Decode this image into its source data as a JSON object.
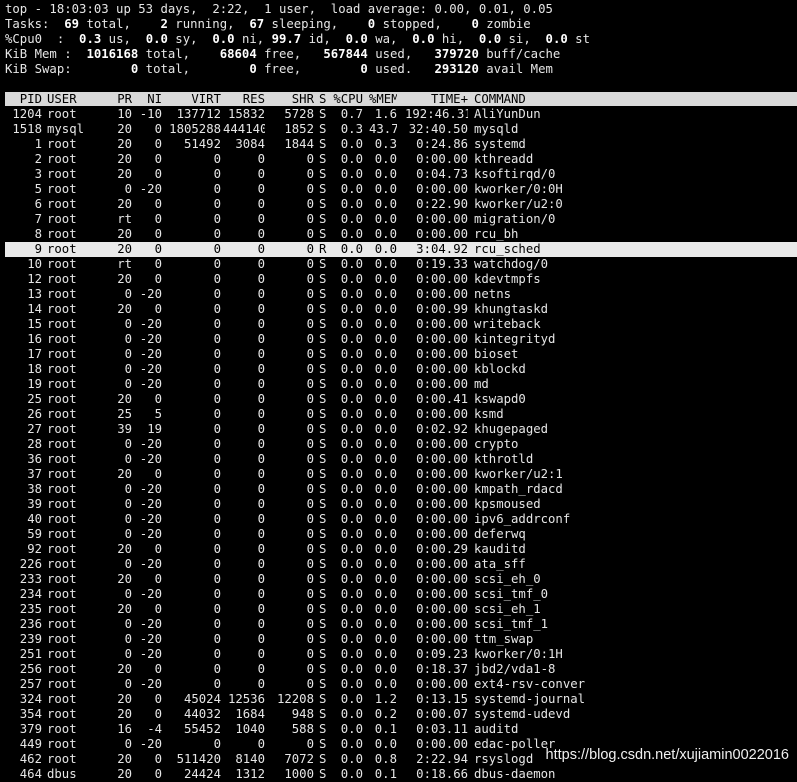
{
  "summary": {
    "top": {
      "time": "18:03:03",
      "uptime": "53 days,  2:22",
      "users": "1",
      "load": "0.00, 0.01, 0.05"
    },
    "tasks": {
      "total": "69",
      "running": "2",
      "sleeping": "67",
      "stopped": "0",
      "zombie": "0"
    },
    "cpu": {
      "us": "0.3",
      "sy": "0.0",
      "ni": "0.0",
      "id": "99.7",
      "wa": "0.0",
      "hi": "0.0",
      "si": "0.0",
      "st": "0.0"
    },
    "mem": {
      "total": "1016168",
      "free": "68604",
      "used": "567844",
      "buff": "379720"
    },
    "swap": {
      "total": "0",
      "free": "0",
      "used": "0",
      "avail": "293120"
    }
  },
  "columns": [
    "PID",
    "USER",
    "PR",
    "NI",
    "VIRT",
    "RES",
    "SHR",
    "S",
    "%CPU",
    "%MEM",
    "TIME+",
    "COMMAND"
  ],
  "processes": [
    [
      "1204",
      "root",
      "10",
      "-10",
      "137712",
      "15832",
      "5728",
      "S",
      "0.7",
      "1.6",
      "192:46.31",
      "AliYunDun"
    ],
    [
      "1518",
      "mysql",
      "20",
      "0",
      "1805288",
      "444140",
      "1852",
      "S",
      "0.3",
      "43.7",
      "32:40.50",
      "mysqld"
    ],
    [
      "1",
      "root",
      "20",
      "0",
      "51492",
      "3084",
      "1844",
      "S",
      "0.0",
      "0.3",
      "0:24.86",
      "systemd"
    ],
    [
      "2",
      "root",
      "20",
      "0",
      "0",
      "0",
      "0",
      "S",
      "0.0",
      "0.0",
      "0:00.00",
      "kthreadd"
    ],
    [
      "3",
      "root",
      "20",
      "0",
      "0",
      "0",
      "0",
      "S",
      "0.0",
      "0.0",
      "0:04.73",
      "ksoftirqd/0"
    ],
    [
      "5",
      "root",
      "0",
      "-20",
      "0",
      "0",
      "0",
      "S",
      "0.0",
      "0.0",
      "0:00.00",
      "kworker/0:0H"
    ],
    [
      "6",
      "root",
      "20",
      "0",
      "0",
      "0",
      "0",
      "S",
      "0.0",
      "0.0",
      "0:22.90",
      "kworker/u2:0"
    ],
    [
      "7",
      "root",
      "rt",
      "0",
      "0",
      "0",
      "0",
      "S",
      "0.0",
      "0.0",
      "0:00.00",
      "migration/0"
    ],
    [
      "8",
      "root",
      "20",
      "0",
      "0",
      "0",
      "0",
      "S",
      "0.0",
      "0.0",
      "0:00.00",
      "rcu_bh"
    ],
    [
      "9",
      "root",
      "20",
      "0",
      "0",
      "0",
      "0",
      "R",
      "0.0",
      "0.0",
      "3:04.92",
      "rcu_sched"
    ],
    [
      "10",
      "root",
      "rt",
      "0",
      "0",
      "0",
      "0",
      "S",
      "0.0",
      "0.0",
      "0:19.33",
      "watchdog/0"
    ],
    [
      "12",
      "root",
      "20",
      "0",
      "0",
      "0",
      "0",
      "S",
      "0.0",
      "0.0",
      "0:00.00",
      "kdevtmpfs"
    ],
    [
      "13",
      "root",
      "0",
      "-20",
      "0",
      "0",
      "0",
      "S",
      "0.0",
      "0.0",
      "0:00.00",
      "netns"
    ],
    [
      "14",
      "root",
      "20",
      "0",
      "0",
      "0",
      "0",
      "S",
      "0.0",
      "0.0",
      "0:00.99",
      "khungtaskd"
    ],
    [
      "15",
      "root",
      "0",
      "-20",
      "0",
      "0",
      "0",
      "S",
      "0.0",
      "0.0",
      "0:00.00",
      "writeback"
    ],
    [
      "16",
      "root",
      "0",
      "-20",
      "0",
      "0",
      "0",
      "S",
      "0.0",
      "0.0",
      "0:00.00",
      "kintegrityd"
    ],
    [
      "17",
      "root",
      "0",
      "-20",
      "0",
      "0",
      "0",
      "S",
      "0.0",
      "0.0",
      "0:00.00",
      "bioset"
    ],
    [
      "18",
      "root",
      "0",
      "-20",
      "0",
      "0",
      "0",
      "S",
      "0.0",
      "0.0",
      "0:00.00",
      "kblockd"
    ],
    [
      "19",
      "root",
      "0",
      "-20",
      "0",
      "0",
      "0",
      "S",
      "0.0",
      "0.0",
      "0:00.00",
      "md"
    ],
    [
      "25",
      "root",
      "20",
      "0",
      "0",
      "0",
      "0",
      "S",
      "0.0",
      "0.0",
      "0:00.41",
      "kswapd0"
    ],
    [
      "26",
      "root",
      "25",
      "5",
      "0",
      "0",
      "0",
      "S",
      "0.0",
      "0.0",
      "0:00.00",
      "ksmd"
    ],
    [
      "27",
      "root",
      "39",
      "19",
      "0",
      "0",
      "0",
      "S",
      "0.0",
      "0.0",
      "0:02.92",
      "khugepaged"
    ],
    [
      "28",
      "root",
      "0",
      "-20",
      "0",
      "0",
      "0",
      "S",
      "0.0",
      "0.0",
      "0:00.00",
      "crypto"
    ],
    [
      "36",
      "root",
      "0",
      "-20",
      "0",
      "0",
      "0",
      "S",
      "0.0",
      "0.0",
      "0:00.00",
      "kthrotld"
    ],
    [
      "37",
      "root",
      "20",
      "0",
      "0",
      "0",
      "0",
      "S",
      "0.0",
      "0.0",
      "0:00.00",
      "kworker/u2:1"
    ],
    [
      "38",
      "root",
      "0",
      "-20",
      "0",
      "0",
      "0",
      "S",
      "0.0",
      "0.0",
      "0:00.00",
      "kmpath_rdacd"
    ],
    [
      "39",
      "root",
      "0",
      "-20",
      "0",
      "0",
      "0",
      "S",
      "0.0",
      "0.0",
      "0:00.00",
      "kpsmoused"
    ],
    [
      "40",
      "root",
      "0",
      "-20",
      "0",
      "0",
      "0",
      "S",
      "0.0",
      "0.0",
      "0:00.00",
      "ipv6_addrconf"
    ],
    [
      "59",
      "root",
      "0",
      "-20",
      "0",
      "0",
      "0",
      "S",
      "0.0",
      "0.0",
      "0:00.00",
      "deferwq"
    ],
    [
      "92",
      "root",
      "20",
      "0",
      "0",
      "0",
      "0",
      "S",
      "0.0",
      "0.0",
      "0:00.29",
      "kauditd"
    ],
    [
      "226",
      "root",
      "0",
      "-20",
      "0",
      "0",
      "0",
      "S",
      "0.0",
      "0.0",
      "0:00.00",
      "ata_sff"
    ],
    [
      "233",
      "root",
      "20",
      "0",
      "0",
      "0",
      "0",
      "S",
      "0.0",
      "0.0",
      "0:00.00",
      "scsi_eh_0"
    ],
    [
      "234",
      "root",
      "0",
      "-20",
      "0",
      "0",
      "0",
      "S",
      "0.0",
      "0.0",
      "0:00.00",
      "scsi_tmf_0"
    ],
    [
      "235",
      "root",
      "20",
      "0",
      "0",
      "0",
      "0",
      "S",
      "0.0",
      "0.0",
      "0:00.00",
      "scsi_eh_1"
    ],
    [
      "236",
      "root",
      "0",
      "-20",
      "0",
      "0",
      "0",
      "S",
      "0.0",
      "0.0",
      "0:00.00",
      "scsi_tmf_1"
    ],
    [
      "239",
      "root",
      "0",
      "-20",
      "0",
      "0",
      "0",
      "S",
      "0.0",
      "0.0",
      "0:00.00",
      "ttm_swap"
    ],
    [
      "251",
      "root",
      "0",
      "-20",
      "0",
      "0",
      "0",
      "S",
      "0.0",
      "0.0",
      "0:09.23",
      "kworker/0:1H"
    ],
    [
      "256",
      "root",
      "20",
      "0",
      "0",
      "0",
      "0",
      "S",
      "0.0",
      "0.0",
      "0:18.37",
      "jbd2/vda1-8"
    ],
    [
      "257",
      "root",
      "0",
      "-20",
      "0",
      "0",
      "0",
      "S",
      "0.0",
      "0.0",
      "0:00.00",
      "ext4-rsv-conver"
    ],
    [
      "324",
      "root",
      "20",
      "0",
      "45024",
      "12536",
      "12208",
      "S",
      "0.0",
      "1.2",
      "0:13.15",
      "systemd-journal"
    ],
    [
      "354",
      "root",
      "20",
      "0",
      "44032",
      "1684",
      "948",
      "S",
      "0.0",
      "0.2",
      "0:00.07",
      "systemd-udevd"
    ],
    [
      "379",
      "root",
      "16",
      "-4",
      "55452",
      "1040",
      "588",
      "S",
      "0.0",
      "0.1",
      "0:03.11",
      "auditd"
    ],
    [
      "449",
      "root",
      "0",
      "-20",
      "0",
      "0",
      "0",
      "S",
      "0.0",
      "0.0",
      "0:00.00",
      "edac-poller"
    ],
    [
      "462",
      "root",
      "20",
      "0",
      "511420",
      "8140",
      "7072",
      "S",
      "0.0",
      "0.8",
      "2:22.94",
      "rsyslogd"
    ],
    [
      "464",
      "dbus",
      "20",
      "0",
      "24424",
      "1312",
      "1000",
      "S",
      "0.0",
      "0.1",
      "0:18.66",
      "dbus-daemon"
    ]
  ],
  "selected_pid": "9",
  "watermark": "https://blog.csdn.net/xujiamin0022016"
}
